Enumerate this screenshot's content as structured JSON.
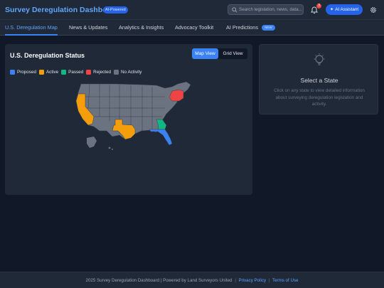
{
  "header": {
    "title": "Survey Deregulation Dashboard",
    "ai_badge": "AI-Powered",
    "search_placeholder": "Search legislation, news, data...",
    "notification_count": "3",
    "ai_assistant_label": "AI Assistant",
    "icons": [
      "search-icon",
      "bell-icon",
      "sparkle-icon",
      "gear-icon"
    ]
  },
  "nav": {
    "tabs": [
      {
        "label": "U.S. Deregulation Map",
        "active": true
      },
      {
        "label": "News & Updates",
        "active": false
      },
      {
        "label": "Analytics & Insights",
        "active": false
      },
      {
        "label": "Advocacy Toolkit",
        "active": false
      },
      {
        "label": "AI Predictions",
        "active": false,
        "badge": "NEW"
      }
    ]
  },
  "map_panel": {
    "title": "U.S. Deregulation Status",
    "views": [
      "Map View",
      "Grid View"
    ],
    "active_view": "Map View",
    "legend": [
      {
        "label": "Proposed",
        "color": "#3b82f6"
      },
      {
        "label": "Active",
        "color": "#f59e0b"
      },
      {
        "label": "Passed",
        "color": "#10b981"
      },
      {
        "label": "Rejected",
        "color": "#ef4444"
      },
      {
        "label": "No Activity",
        "color": "#6b7280"
      }
    ],
    "state_status": {
      "California": "Active",
      "Texas": "Active",
      "Florida": "Proposed",
      "Georgia": "Passed",
      "New York": "Rejected"
    }
  },
  "detail_panel": {
    "title": "Select a State",
    "description": "Click on any state to view detailed information about surveying deregulation legislation and activity.",
    "icon": "lightbulb-icon"
  },
  "footer": {
    "text": "2025 Survey Deregulation Dashboard | Powered by Land Surveyors United",
    "privacy": "Privacy Policy",
    "terms": "Terms of Use",
    "separator": "|"
  }
}
